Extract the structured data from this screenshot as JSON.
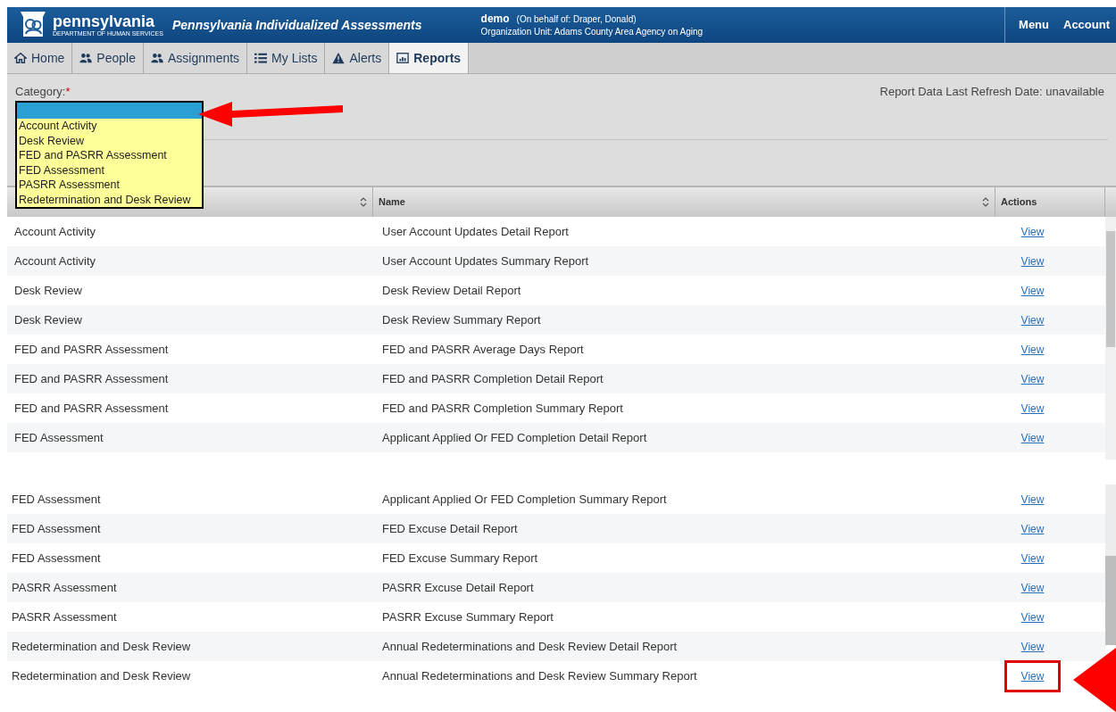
{
  "header": {
    "logo_title": "pennsylvania",
    "logo_subtitle": "DEPARTMENT OF HUMAN SERVICES",
    "app_title": "Pennsylvania Individualized Assessments",
    "user": "demo",
    "on_behalf": "(On behalf of: Draper, Donald)",
    "org_unit": "Organization Unit: Adams County Area Agency on Aging",
    "nav": [
      "Menu",
      "Account"
    ]
  },
  "tabs": [
    {
      "label": "Home",
      "kind": "home",
      "selected": false
    },
    {
      "label": "People",
      "kind": "people",
      "selected": false
    },
    {
      "label": "Assignments",
      "kind": "people",
      "selected": false
    },
    {
      "label": "My Lists",
      "kind": "list",
      "selected": false
    },
    {
      "label": "Alerts",
      "kind": "alert",
      "selected": false
    },
    {
      "label": "Reports",
      "kind": "report",
      "selected": true
    }
  ],
  "filter": {
    "label": "Category:",
    "required_mark": "*",
    "refresh": "Report Data Last Refresh Date: unavailable",
    "dropdown": {
      "blank_option_highlighted": true,
      "options": [
        {
          "label": "Account Activity",
          "selected": false
        },
        {
          "label": "Desk Review",
          "selected": false
        },
        {
          "label": "FED and PASRR Assessment",
          "selected": false
        },
        {
          "label": "FED Assessment",
          "selected": false
        },
        {
          "label": "PASRR Assessment",
          "selected": false
        },
        {
          "label": "Redetermination and Desk Review",
          "selected": false
        }
      ]
    }
  },
  "table": {
    "columns": [
      {
        "sortable": true
      },
      {
        "label": "Name",
        "sortable": true
      },
      {
        "label": "Actions",
        "sortable": false
      }
    ],
    "rows": [
      {
        "category": "Account Activity",
        "name": "User Account Updates Detail Report",
        "action": "View"
      },
      {
        "category": "Account Activity",
        "name": "User Account Updates Summary Report",
        "action": "View"
      },
      {
        "category": "Desk Review",
        "name": "Desk Review Detail Report",
        "action": "View"
      },
      {
        "category": "Desk Review",
        "name": "Desk Review Summary Report",
        "action": "View"
      },
      {
        "category": "FED and PASRR Assessment",
        "name": "FED and PASRR Average Days Report",
        "action": "View"
      },
      {
        "category": "FED and PASRR Assessment",
        "name": "FED and PASRR Completion Detail Report",
        "action": "View"
      },
      {
        "category": "FED and PASRR Assessment",
        "name": "FED and PASRR Completion Summary Report",
        "action": "View"
      },
      {
        "category": "FED Assessment",
        "name": "Applicant Applied Or FED Completion Detail Report",
        "action": "View"
      }
    ]
  },
  "table_continued": {
    "rows": [
      {
        "category": "FED Assessment",
        "name": "Applicant Applied Or FED Completion Summary Report",
        "action": "View",
        "highlighted": false
      },
      {
        "category": "FED Assessment",
        "name": "FED Excuse Detail Report",
        "action": "View",
        "highlighted": false
      },
      {
        "category": "FED Assessment",
        "name": "FED Excuse Summary Report",
        "action": "View",
        "highlighted": false
      },
      {
        "category": "PASRR Assessment",
        "name": "PASRR Excuse Detail Report",
        "action": "View",
        "highlighted": false
      },
      {
        "category": "PASRR Assessment",
        "name": "PASRR Excuse Summary Report",
        "action": "View",
        "highlighted": false
      },
      {
        "category": "Redetermination and Desk Review",
        "name": "Annual Redeterminations and Desk Review Detail Report",
        "action": "View",
        "highlighted": false
      },
      {
        "category": "Redetermination and Desk Review",
        "name": "Annual Redeterminations and Desk Review Summary Report",
        "action": "View",
        "highlighted": true
      }
    ]
  },
  "annotations": {
    "dropdown_arrow": true,
    "corner_arrow": true
  }
}
